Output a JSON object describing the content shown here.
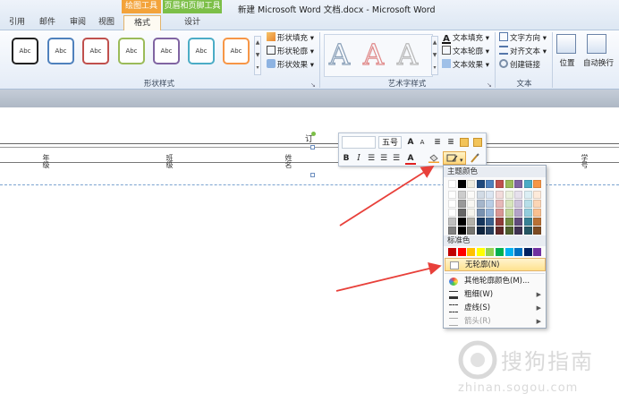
{
  "window": {
    "title": "新建 Microsoft Word 文档.docx - Microsoft Word"
  },
  "tabs": [
    {
      "label": "引用"
    },
    {
      "label": "邮件"
    },
    {
      "label": "审阅"
    },
    {
      "label": "视图"
    },
    {
      "label": "格式"
    },
    {
      "label": "设计"
    }
  ],
  "context_tabs": {
    "drawing_tools": "绘图工具",
    "header_footer_tools": "页眉和页脚工具"
  },
  "ribbon": {
    "shape_style_label": "Abc",
    "shape_fill": "形状填充",
    "shape_outline": "形状轮廓",
    "shape_effects": "形状效果",
    "group_shape_styles": "形状样式",
    "text_fill": "文本填充",
    "text_outline": "文本轮廓",
    "text_effects": "文本效果",
    "group_wordart": "艺术字样式",
    "text_direction": "文字方向",
    "align_text": "对齐文本",
    "create_link": "创建链接",
    "group_text": "文本",
    "position": "位置",
    "wrap_text": "自动换行"
  },
  "document": {
    "fields": [
      {
        "label": "年级"
      },
      {
        "label": "班级"
      },
      {
        "label": "姓名"
      },
      {
        "label": "学号"
      }
    ],
    "edit_mark": "订"
  },
  "mini_toolbar": {
    "font_size": "五号",
    "bold": "B",
    "italic": "I",
    "font_color_letter": "A",
    "grow_font": "A",
    "shrink_font": "A"
  },
  "menu": {
    "theme_colors_header": "主题颜色",
    "standard_colors_header": "标准色",
    "no_outline": "无轮廓(N)",
    "more_colors": "其他轮廓颜色(M)...",
    "weight": "粗细(W)",
    "dashes": "虚线(S)",
    "arrows": "箭头(R)",
    "standard_colors": [
      "#c00000",
      "#ff0000",
      "#ffc000",
      "#ffff00",
      "#92d050",
      "#00b050",
      "#00b0f0",
      "#0070c0",
      "#002060",
      "#7030a0"
    ],
    "theme_top_row": [
      "#ffffff",
      "#000000",
      "#eeece1",
      "#1f497d",
      "#4f81bd",
      "#c0504d",
      "#9bbb59",
      "#8064a2",
      "#4bacc6",
      "#f79646"
    ]
  },
  "watermark": {
    "text": "搜狗指南",
    "url": "zhinan.sogou.com"
  },
  "colors": {
    "arrow": "#e8403a",
    "accent_orange": "#f4a12a",
    "accent_green": "#7cbf48"
  }
}
